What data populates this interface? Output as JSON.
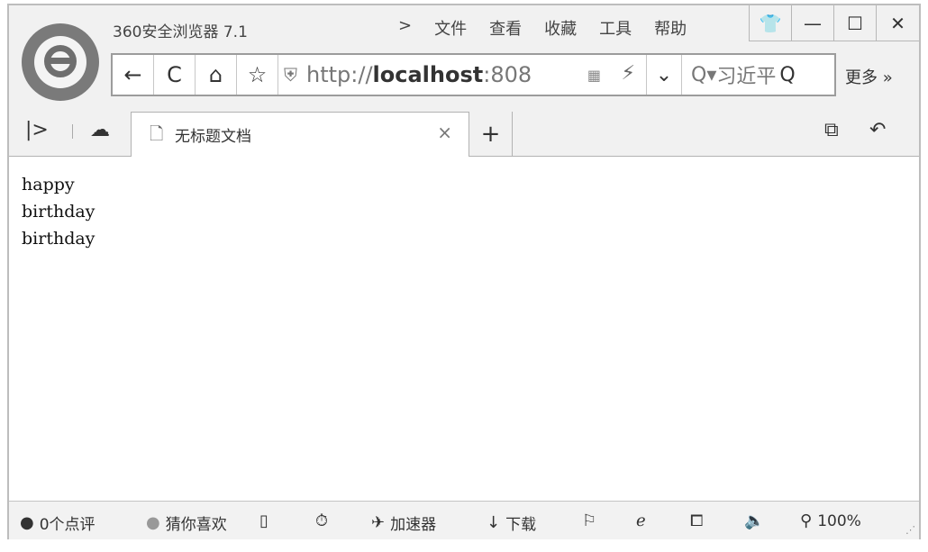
{
  "app": {
    "title": "360安全浏览器 7.1"
  },
  "menu": {
    "expand": ">",
    "items": [
      "文件",
      "查看",
      "收藏",
      "工具",
      "帮助"
    ]
  },
  "window_controls": {
    "skin": "👕",
    "minimize": "—",
    "maximize": "☐",
    "close": "✕"
  },
  "nav": {
    "back": "←",
    "reload": "C",
    "home": "⌂",
    "favorite": "☆",
    "url_prefix": "http://",
    "url_host": "localhost",
    "url_suffix": ":808",
    "dropdown": "⌄",
    "search_prefix": "Q▾",
    "search_text": "习近平",
    "search_icon": "Q",
    "more": "更多 »"
  },
  "tabs": {
    "items": [
      {
        "title": "无标题文档",
        "close": "×"
      }
    ],
    "new_tab": "+"
  },
  "page": {
    "lines": [
      "happy",
      "birthday",
      "birthday"
    ]
  },
  "status": {
    "reviews": "0个点评",
    "recommend": "猜你喜欢",
    "accelerator": "加速器",
    "download": "下载",
    "zoom": "100%"
  }
}
